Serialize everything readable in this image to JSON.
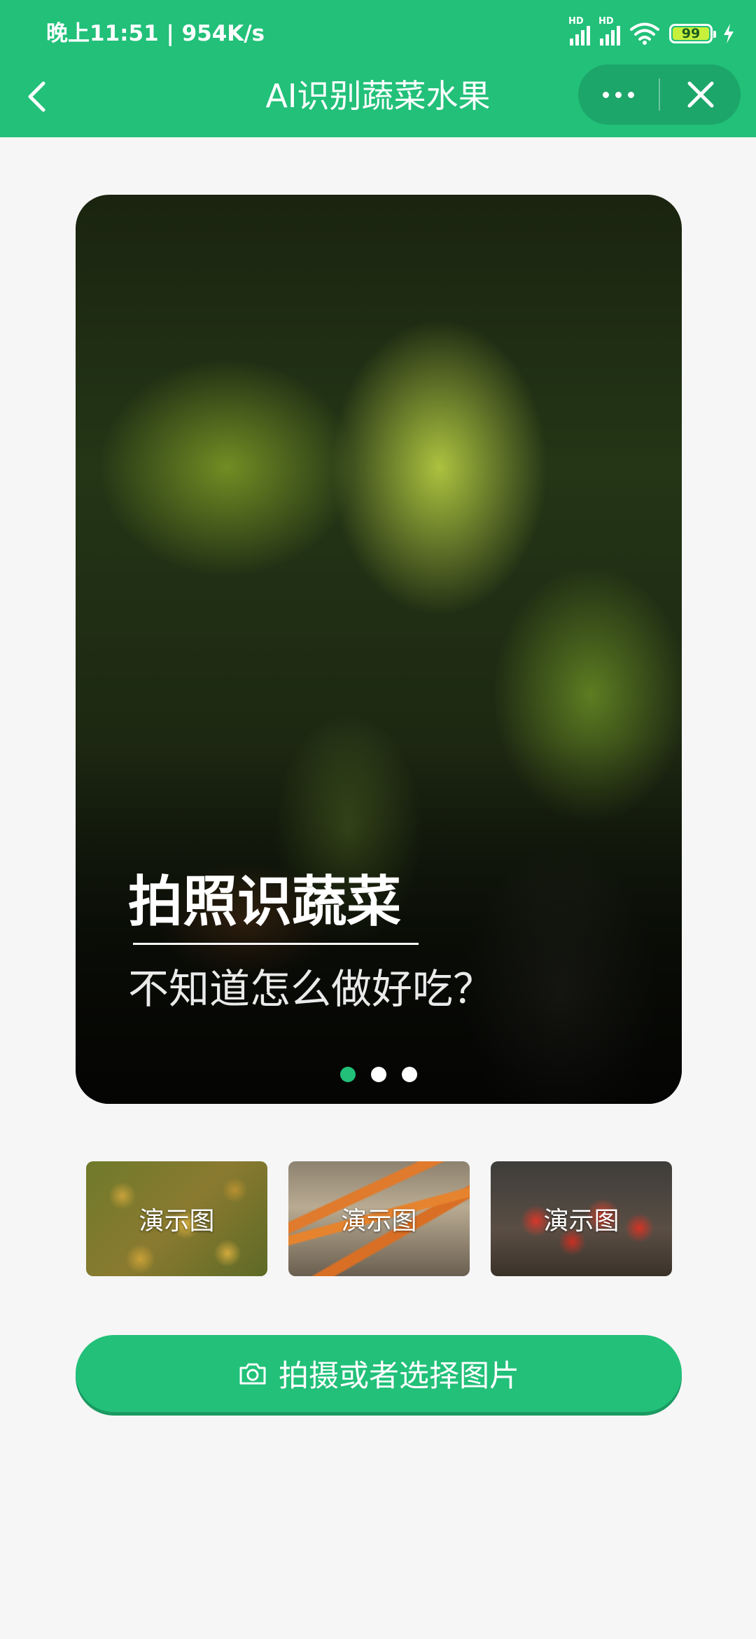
{
  "status_bar": {
    "time": "晚上11:51 | 954K/s",
    "battery": "99",
    "network_badge": "HD"
  },
  "navbar": {
    "title": "AI识别蔬菜水果"
  },
  "hero": {
    "title": "拍照识蔬菜",
    "subtitle": "不知道怎么做好吃？",
    "active_slide": 1,
    "slide_count": 3
  },
  "demos": [
    {
      "label": "演示图"
    },
    {
      "label": "演示图"
    },
    {
      "label": "演示图"
    }
  ],
  "action": {
    "label": "拍摄或者选择图片"
  },
  "colors": {
    "brand_green": "#22c079",
    "background": "#f6f6f6"
  },
  "icons": [
    "back-arrow-icon",
    "more-dots-icon",
    "close-icon",
    "camera-icon",
    "wifi-icon",
    "signal-icon",
    "battery-icon",
    "charging-icon"
  ]
}
